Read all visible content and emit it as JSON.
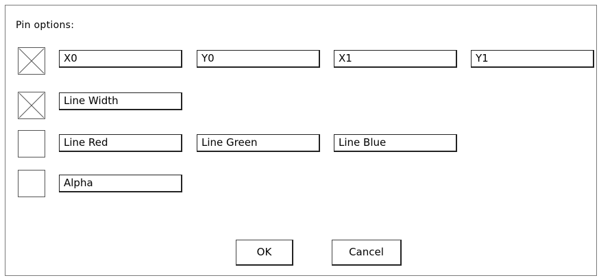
{
  "dialog": {
    "title": "Pin options:",
    "rows": [
      {
        "checked": true,
        "fields": [
          "X0",
          "Y0",
          "X1",
          "Y1"
        ]
      },
      {
        "checked": true,
        "fields": [
          "Line Width"
        ]
      },
      {
        "checked": false,
        "fields": [
          "Line Red",
          "Line Green",
          "Line Blue"
        ]
      },
      {
        "checked": false,
        "fields": [
          "Alpha"
        ]
      }
    ],
    "ok_label": "OK",
    "cancel_label": "Cancel"
  }
}
